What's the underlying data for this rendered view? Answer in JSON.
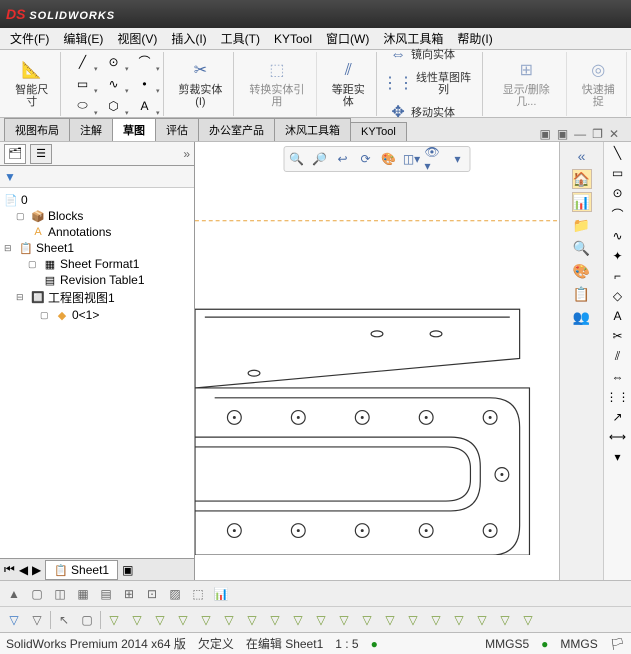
{
  "title": "SOLIDWORKS",
  "menu": [
    "文件(F)",
    "编辑(E)",
    "视图(V)",
    "插入(I)",
    "工具(T)",
    "KYTool",
    "窗口(W)",
    "沐风工具箱",
    "帮助(I)"
  ],
  "ribbon": {
    "smartdim": "智能尺寸",
    "trim": "剪裁实体(I)",
    "convert": "转换实体引用",
    "offset": "等距实体",
    "mirror": "镜向实体",
    "pattern": "线性草图阵列",
    "move": "移动实体",
    "display": "显示/删除几...",
    "quicksnap": "快速捕捉"
  },
  "tabs": [
    "视图布局",
    "注解",
    "草图",
    "评估",
    "办公室产品",
    "沐风工具箱",
    "KYTool"
  ],
  "activeTab": 2,
  "tree": {
    "root": "0",
    "blocks": "Blocks",
    "annotations": "Annotations",
    "sheet": "Sheet1",
    "sheetformat": "Sheet Format1",
    "revtable": "Revision Table1",
    "drawview": "工程图视图1",
    "part": "0<1>"
  },
  "sheetTab": "Sheet1",
  "status": {
    "product": "SolidWorks Premium 2014 x64 版",
    "underdef": "欠定义",
    "editing": "在编辑 Sheet1",
    "scale": "1 : 5",
    "units1": "MMGS5",
    "units2": "MMGS"
  }
}
